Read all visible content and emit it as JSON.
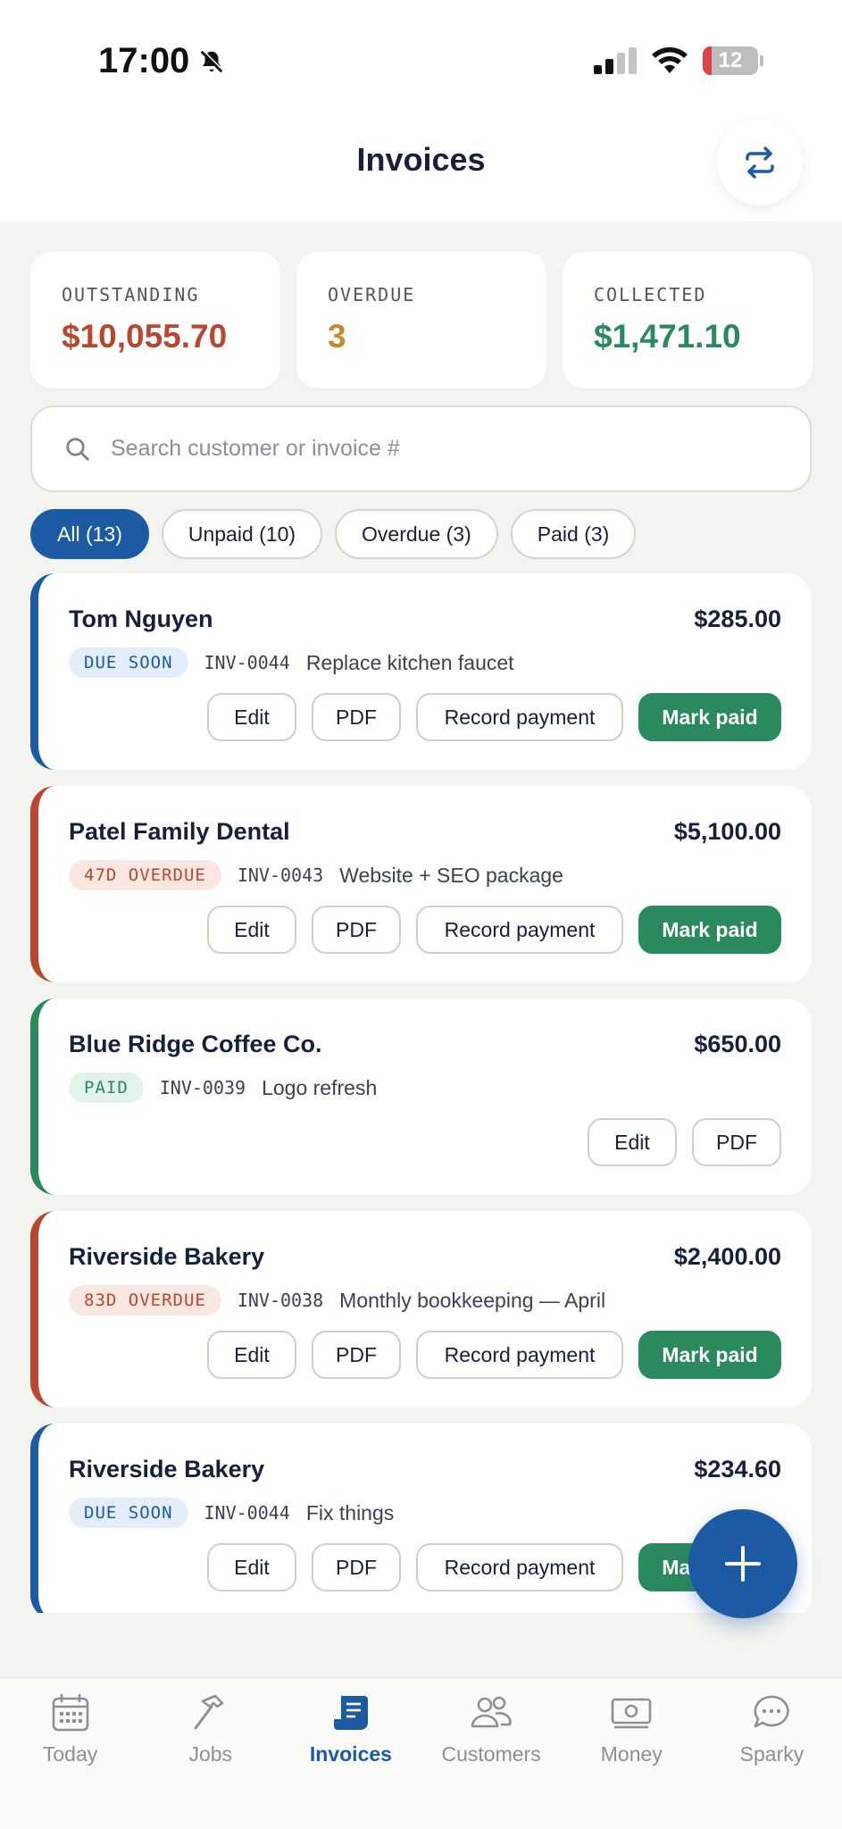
{
  "status": {
    "time": "17:00",
    "battery": "12"
  },
  "header": {
    "title": "Invoices"
  },
  "stats": [
    {
      "label": "OUTSTANDING",
      "value": "$10,055.70",
      "color": "#b9462e"
    },
    {
      "label": "OVERDUE",
      "value": "3",
      "color": "#c5892b"
    },
    {
      "label": "COLLECTED",
      "value": "$1,471.10",
      "color": "#2a8a5d"
    }
  ],
  "search": {
    "placeholder": "Search customer or invoice #",
    "value": ""
  },
  "filters": [
    {
      "label": "All (13)",
      "active": true
    },
    {
      "label": "Unpaid (10)",
      "active": false
    },
    {
      "label": "Overdue (3)",
      "active": false
    },
    {
      "label": "Paid (3)",
      "active": false
    }
  ],
  "invoices": [
    {
      "customer": "Tom Nguyen",
      "amount": "$285.00",
      "badge": "DUE SOON",
      "status": "due",
      "number": "INV-0044",
      "description": "Replace kitchen faucet",
      "edit": "Edit",
      "pdf": "PDF",
      "record": "Record payment",
      "mark": "Mark paid"
    },
    {
      "customer": "Patel Family Dental",
      "amount": "$5,100.00",
      "badge": "47D OVERDUE",
      "status": "overdue",
      "number": "INV-0043",
      "description": "Website + SEO package",
      "edit": "Edit",
      "pdf": "PDF",
      "record": "Record payment",
      "mark": "Mark paid"
    },
    {
      "customer": "Blue Ridge Coffee Co.",
      "amount": "$650.00",
      "badge": "PAID",
      "status": "paid",
      "number": "INV-0039",
      "description": "Logo refresh",
      "edit": "Edit",
      "pdf": "PDF"
    },
    {
      "customer": "Riverside Bakery",
      "amount": "$2,400.00",
      "badge": "83D OVERDUE",
      "status": "overdue",
      "number": "INV-0038",
      "description": "Monthly bookkeeping — April",
      "edit": "Edit",
      "pdf": "PDF",
      "record": "Record payment",
      "mark": "Mark paid"
    },
    {
      "customer": "Riverside Bakery",
      "amount": "$234.60",
      "badge": "DUE SOON",
      "status": "due",
      "number": "INV-0044",
      "description": "Fix things",
      "edit": "Edit",
      "pdf": "PDF",
      "record": "Record payment",
      "mark": "Mark paid"
    }
  ],
  "status_colors": {
    "due": {
      "bar": "#1c5aa4",
      "badge_bg": "#e4eefa",
      "badge_fg": "#1c5aa4"
    },
    "overdue": {
      "bar": "#b9462e",
      "badge_bg": "#fbe7e1",
      "badge_fg": "#b9462e"
    },
    "paid": {
      "bar": "#2a8a5d",
      "badge_bg": "#e2f4ea",
      "badge_fg": "#2a8a5d"
    }
  },
  "tabs": [
    {
      "label": "Today",
      "icon": "calendar-icon",
      "active": false
    },
    {
      "label": "Jobs",
      "icon": "hammer-icon",
      "active": false
    },
    {
      "label": "Invoices",
      "icon": "invoice-icon",
      "active": true
    },
    {
      "label": "Customers",
      "icon": "users-icon",
      "active": false
    },
    {
      "label": "Money",
      "icon": "cash-icon",
      "active": false
    },
    {
      "label": "Sparky",
      "icon": "chat-bubble-icon",
      "active": false
    }
  ]
}
